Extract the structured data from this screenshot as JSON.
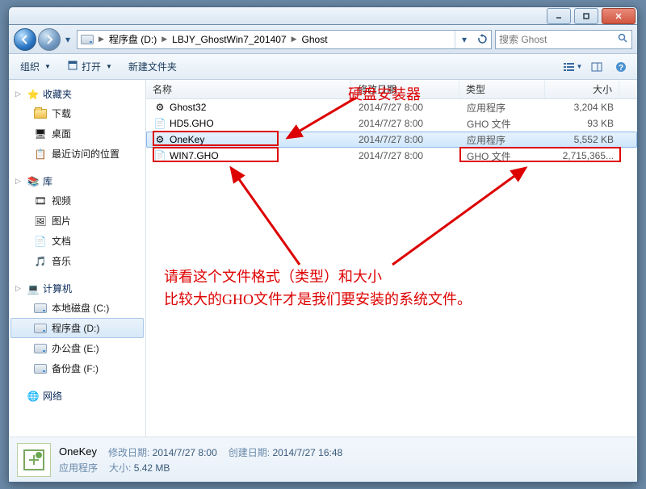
{
  "breadcrumb": {
    "drive_label": "程序盘 (D:)",
    "folder1": "LBJY_GhostWin7_201407",
    "folder2": "Ghost"
  },
  "search": {
    "placeholder": "搜索 Ghost"
  },
  "toolbar": {
    "organize": "组织",
    "open": "打开",
    "newfolder": "新建文件夹"
  },
  "columns": {
    "name": "名称",
    "date": "修改日期",
    "type": "类型",
    "size": "大小"
  },
  "files": [
    {
      "name": "Ghost32",
      "date": "2014/7/27 8:00",
      "type": "应用程序",
      "size": "3,204 KB",
      "icon": "app"
    },
    {
      "name": "HD5.GHO",
      "date": "2014/7/27 8:00",
      "type": "GHO 文件",
      "size": "93 KB",
      "icon": "file"
    },
    {
      "name": "OneKey",
      "date": "2014/7/27 8:00",
      "type": "应用程序",
      "size": "5,552 KB",
      "icon": "app"
    },
    {
      "name": "WIN7.GHO",
      "date": "2014/7/27 8:00",
      "type": "GHO 文件",
      "size": "2,715,365...",
      "icon": "file"
    }
  ],
  "sidebar": {
    "fav": "收藏夹",
    "fav_items": [
      "下载",
      "桌面",
      "最近访问的位置"
    ],
    "lib": "库",
    "lib_items": [
      "视频",
      "图片",
      "文档",
      "音乐"
    ],
    "comp": "计算机",
    "comp_items": [
      "本地磁盘 (C:)",
      "程序盘 (D:)",
      "办公盘 (E:)",
      "备份盘 (F:)"
    ],
    "net": "网络"
  },
  "annotations": {
    "label1": "硬盘安装器",
    "label2_l1": "请看这个文件格式（类型）和大小",
    "label2_l2": "比较大的GHO文件才是我们要安装的系统文件。"
  },
  "status": {
    "filename": "OneKey",
    "line1_k1": "修改日期:",
    "line1_v1": "2014/7/27 8:00",
    "line1_k2": "创建日期:",
    "line1_v2": "2014/7/27 16:48",
    "line2_k1": "应用程序",
    "line2_k2": "大小:",
    "line2_v2": "5.42 MB"
  }
}
